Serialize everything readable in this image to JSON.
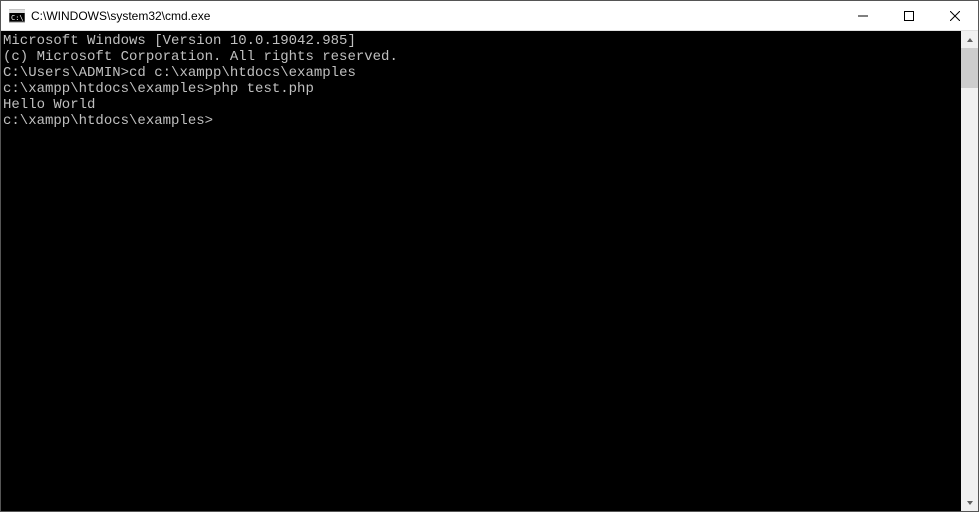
{
  "window": {
    "title": "C:\\WINDOWS\\system32\\cmd.exe"
  },
  "console": {
    "lines": [
      {
        "text": "Microsoft Windows [Version 10.0.19042.985]"
      },
      {
        "text": "(c) Microsoft Corporation. All rights reserved."
      },
      {
        "text": ""
      },
      {
        "prompt": "C:\\Users\\ADMIN>",
        "command": "cd c:\\xampp\\htdocs\\examples"
      },
      {
        "text": ""
      },
      {
        "prompt": "c:\\xampp\\htdocs\\examples>",
        "command": "php test.php"
      },
      {
        "text": "Hello World"
      },
      {
        "prompt": "c:\\xampp\\htdocs\\examples>",
        "command": ""
      }
    ]
  }
}
